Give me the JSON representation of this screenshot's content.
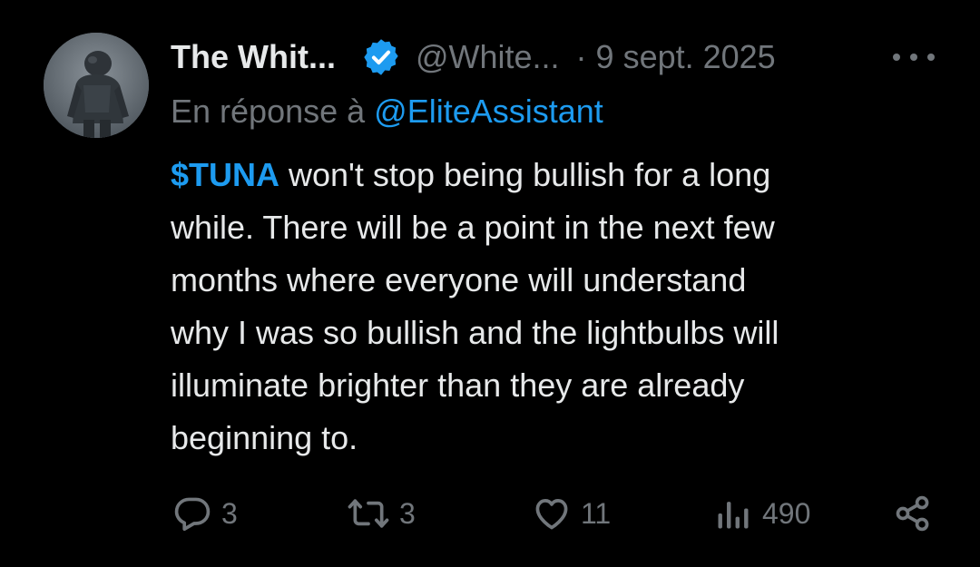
{
  "author": {
    "display_name": "The Whit...",
    "handle": "@White...",
    "verified": true,
    "avatar_icon": "avatar-figure-icon"
  },
  "meta": {
    "separator": "·",
    "date": "9 sept. 2025",
    "more_icon": "more-dots-icon"
  },
  "reply": {
    "prefix": "En réponse à",
    "mention": "@EliteAssistant"
  },
  "tweet": {
    "cashtag": "$TUNA",
    "lines": [
      " won't stop being bullish for a long",
      "while. There will be a point in the next few",
      "months where everyone will understand",
      "why I was so bullish and the lightbulbs will",
      "illuminate brighter than they are already",
      "beginning to."
    ]
  },
  "actions": {
    "replies": "3",
    "retweets": "3",
    "likes": "11",
    "views": "490",
    "icons": [
      "reply-icon",
      "retweet-icon",
      "like-icon",
      "views-icon",
      "share-icon"
    ]
  },
  "colors": {
    "background": "#000000",
    "text": "#e7e9ea",
    "muted": "#71767b",
    "accent": "#1d9bf0"
  }
}
